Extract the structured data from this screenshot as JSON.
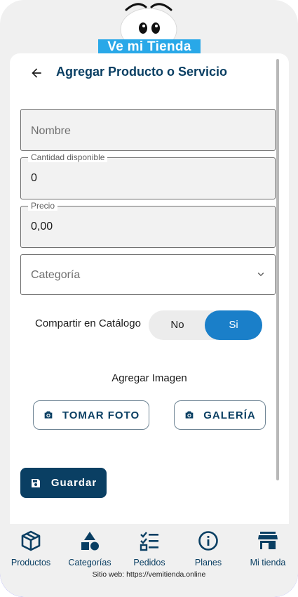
{
  "brand": {
    "name": "Ve mi Tienda"
  },
  "header": {
    "title": "Agregar Producto o Servicio"
  },
  "form": {
    "nombre": {
      "placeholder": "Nombre"
    },
    "cantidad": {
      "label": "Cantidad disponible",
      "value": "0"
    },
    "precio": {
      "label": "Precio",
      "value": "0,00"
    },
    "categoria": {
      "placeholder": "Categoría"
    }
  },
  "share": {
    "label": "Compartir en Catálogo",
    "options": [
      "No",
      "Si"
    ],
    "selected": "Si"
  },
  "image": {
    "label": "Agregar Imagen",
    "take_photo": "TOMAR FOTO",
    "gallery": "GALERÍA"
  },
  "save_label": "Guardar",
  "nav": {
    "items": [
      {
        "label": "Productos",
        "icon": "box-icon"
      },
      {
        "label": "Categorías",
        "icon": "shapes-icon"
      },
      {
        "label": "Pedidos",
        "icon": "checklist-icon"
      },
      {
        "label": "Planes",
        "icon": "info-icon"
      },
      {
        "label": "Mi tienda",
        "icon": "store-icon"
      }
    ]
  },
  "footer": {
    "site": "Sitio web: https://vemitienda.online"
  },
  "colors": {
    "primary": "#0a3f63",
    "accent": "#1a7fc9",
    "brand_banner": "#29a8e8"
  }
}
